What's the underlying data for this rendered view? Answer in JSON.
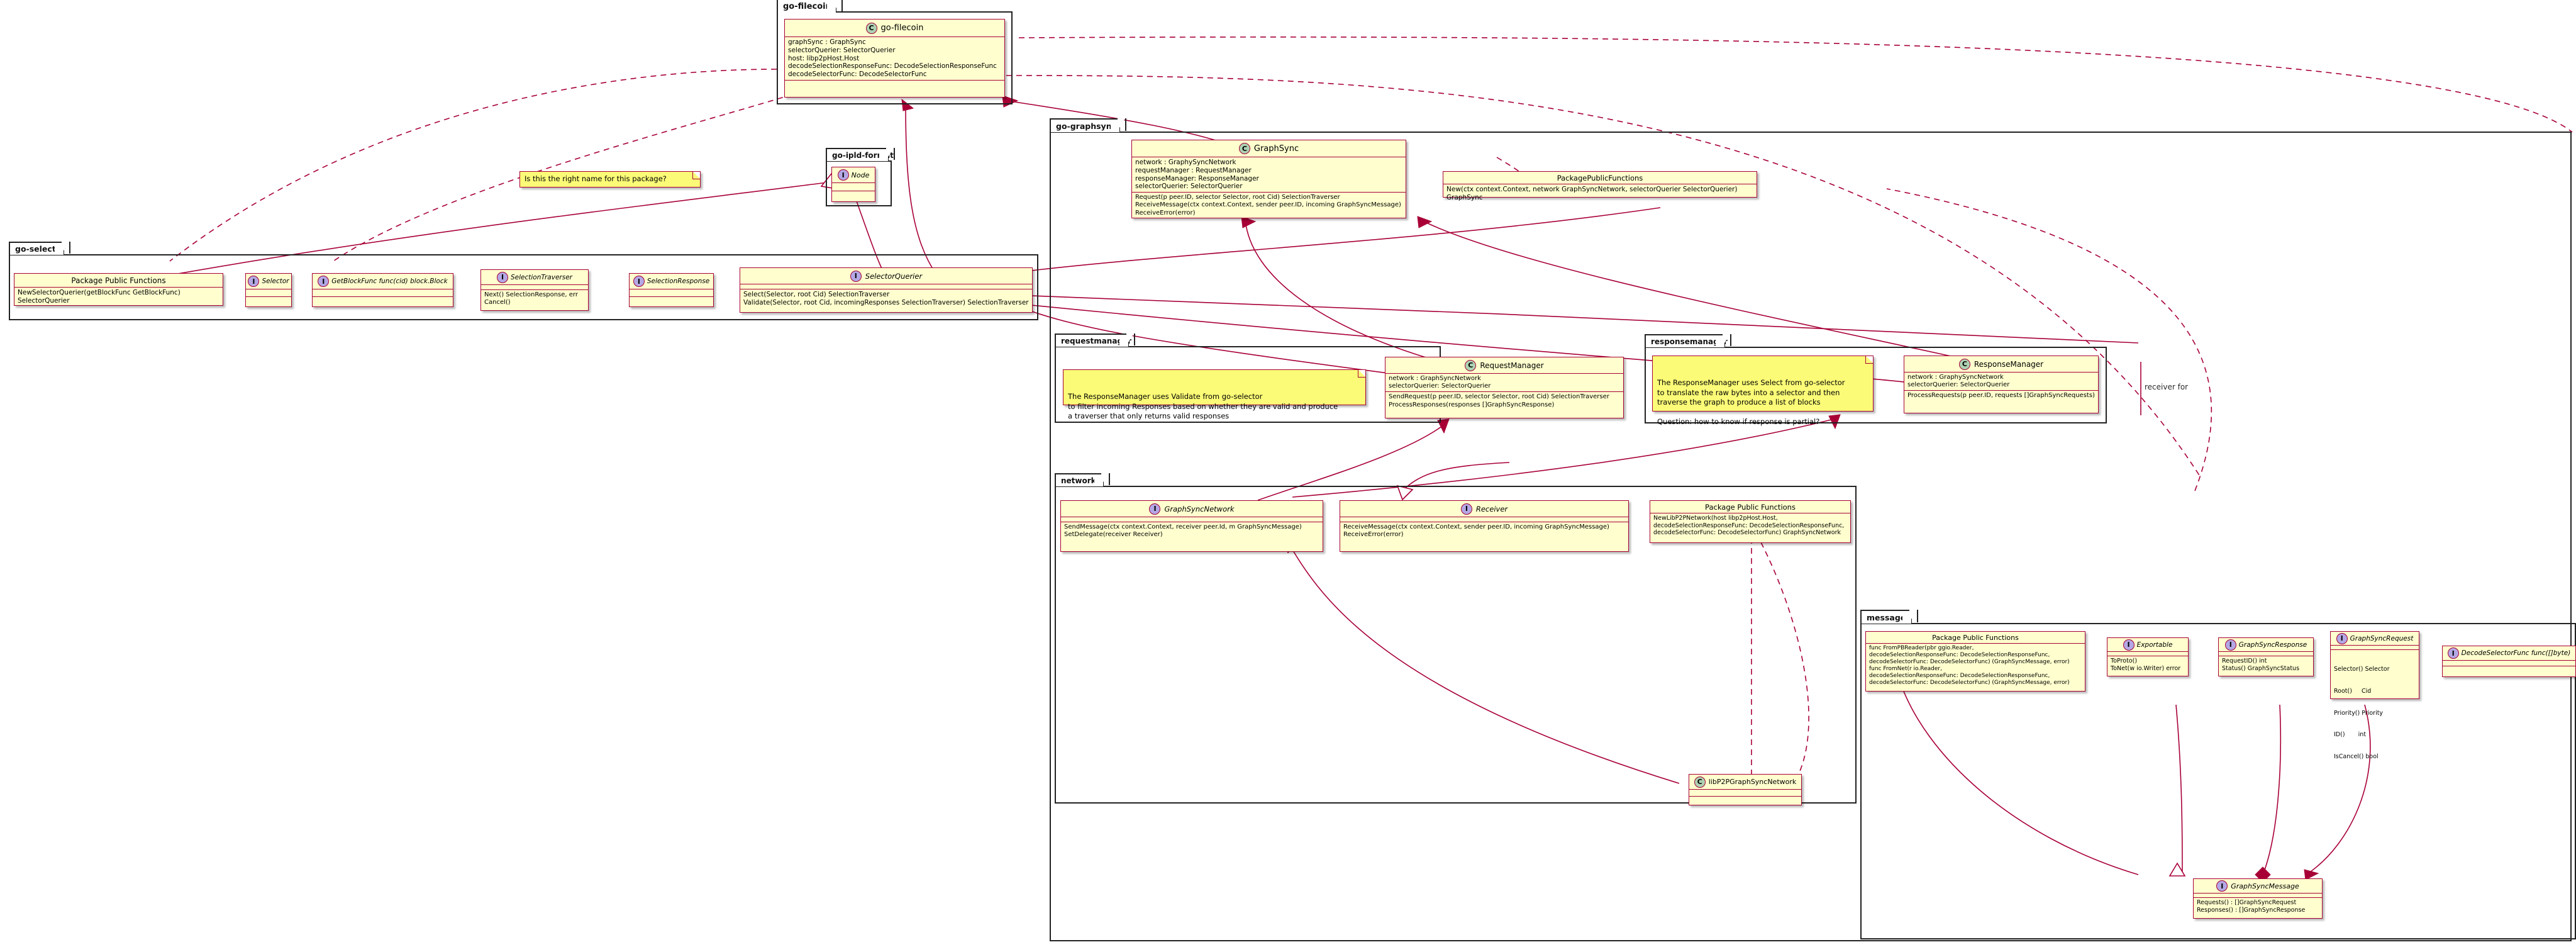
{
  "diagram": {
    "kind": "plantuml-class-diagram",
    "background": "#ffffff",
    "accent": "#A80036",
    "class_fill": "#FEFECE",
    "note_fill": "#FBFB77",
    "class_badge_fill": "#ADD1B2",
    "interface_badge_fill": "#B4A7E5"
  },
  "packages": {
    "go_filecoin": {
      "label": "go-filecoin"
    },
    "go_ipld_format": {
      "label": "go-ipld-format"
    },
    "go_selector": {
      "label": "go-selector"
    },
    "go_graphsync": {
      "label": "go-graphsync"
    },
    "requestmanager": {
      "label": "requestmanager"
    },
    "responsemanager": {
      "label": "responsemanager"
    },
    "network": {
      "label": "network"
    },
    "message": {
      "label": "message"
    }
  },
  "classes": {
    "go_filecoin": {
      "stereotype": "C",
      "name": "go-filecoin",
      "fields": [
        "graphSync : GraphSync",
        "selectorQuerier: SelectorQuerier",
        "host: libp2pHost.Host",
        "decodeSelectionResponseFunc: DecodeSelectionResponseFunc",
        "decodeSelectorFunc: DecodeSelectorFunc"
      ],
      "methods": []
    },
    "node": {
      "stereotype": "I",
      "name": "Node",
      "fields": [],
      "methods": []
    },
    "selector_pkg_funcs": {
      "name": "Package Public Functions",
      "methods": [
        "NewSelectorQuerier(getBlockFunc GetBlockFunc) SelectorQuerier"
      ]
    },
    "selector": {
      "stereotype": "I",
      "name": "Selector",
      "fields": [],
      "methods": []
    },
    "getblockfunc": {
      "stereotype": "I",
      "name": "GetBlockFunc func(cid) block.Block",
      "fields": [],
      "methods": []
    },
    "selection_traverser": {
      "stereotype": "I",
      "name": "SelectionTraverser",
      "fields": [],
      "methods": [
        "Next() SelectionResponse, err",
        "Cancel()"
      ]
    },
    "selection_response": {
      "stereotype": "I",
      "name": "SelectionResponse",
      "fields": [],
      "methods": []
    },
    "selector_querier": {
      "stereotype": "I",
      "name": "SelectorQuerier",
      "fields": [],
      "methods": [
        "Select(Selector, root Cid) SelectionTraverser",
        "Validate(Selector, root Cid, incomingResponses SelectionTraverser) SelectionTraverser"
      ]
    },
    "graphsync": {
      "stereotype": "C",
      "name": "GraphSync",
      "fields": [
        "network : GraphySyncNetwork",
        "requestManager : RequestManager",
        "responseManager: ResponseManager",
        "selectorQuerier: SelectorQuerier"
      ],
      "methods": [
        "Request(p peer.ID, selector Selector, root Cid) SelectionTraverser",
        "ReceiveMessage(ctx context.Context, sender peer.ID, incoming GraphSyncMessage)",
        "ReceiveError(error)"
      ]
    },
    "graphsync_pkg_funcs": {
      "name": "PackagePublicFunctions",
      "methods": [
        "New(ctx context.Context, network GraphSyncNetwork, selectorQuerier SelectorQuerier) GraphSync"
      ]
    },
    "request_manager": {
      "stereotype": "C",
      "name": "RequestManager",
      "fields": [
        "network : GraphSyncNetwork",
        "selectorQuerier: SelectorQuerier"
      ],
      "methods": [
        "SendRequest(p peer.ID, selector Selector, root Cid) SelectionTraverser",
        "ProcessResponses(responses []GraphSyncResponse)"
      ]
    },
    "response_manager": {
      "stereotype": "C",
      "name": "ResponseManager",
      "fields": [
        "network : GraphySyncNetwork",
        "selectorQuerier: SelectorQuerier"
      ],
      "methods": [
        "ProcessRequests(p peer.ID, requests []GraphSyncRequests)"
      ]
    },
    "graphsync_network": {
      "stereotype": "I",
      "name": "GraphSyncNetwork",
      "fields": [],
      "methods": [
        "SendMessage(ctx context.Context, receiver peer.Id, m GraphSyncMessage)",
        "SetDelegate(receiver Receiver)"
      ]
    },
    "receiver": {
      "stereotype": "I",
      "name": "Receiver",
      "fields": [],
      "methods": [
        "ReceiveMessage(ctx context.Context, sender peer.ID, incoming GraphSyncMessage)",
        "ReceiveError(error)"
      ]
    },
    "network_pkg_funcs": {
      "name": "Package Public Functions",
      "methods": [
        "NewLibP2PNetwork(host libp2pHost.Host,",
        "decodeSelectionResponseFunc: DecodeSelectionResponseFunc,",
        "decodeSelectorFunc: DecodeSelectorFunc) GraphSyncNetwork"
      ]
    },
    "libp2p_graphsync_network": {
      "stereotype": "C",
      "name": "libP2PGraphSyncNetwork",
      "fields": [],
      "methods": []
    },
    "message_pkg_funcs": {
      "name": "Package Public Functions",
      "methods": [
        "func FromPBReader(pbr ggio.Reader,",
        "decodeSelectionResponseFunc: DecodeSelectionResponseFunc,",
        "decodeSelectorFunc: DecodeSelectorFunc) (GraphSyncMessage, error)",
        "func FromNet(r io.Reader,",
        "decodeSelectionResponseFunc: DecodeSelectionResponseFunc,",
        "decodeSelectorFunc: DecodeSelectorFunc) (GraphSyncMessage, error)"
      ]
    },
    "exportable": {
      "stereotype": "I",
      "name": "Exportable",
      "fields": [],
      "methods": [
        "ToProto()",
        "ToNet(w io.Writer) error"
      ]
    },
    "graphsync_response": {
      "stereotype": "I",
      "name": "GraphSyncResponse",
      "fields": [],
      "methods": [
        "RequestID() int",
        "Status() GraphSyncStatus"
      ]
    },
    "graphsync_request": {
      "stereotype": "I",
      "name": "GraphSyncRequest",
      "fields": [],
      "methods": [
        "Selector() Selector",
        "Root()     Cid",
        "Priority() Priority",
        "ID()       int",
        "IsCancel() bool"
      ]
    },
    "decode_selector_func": {
      "stereotype": "I",
      "name": "DecodeSelectorFunc func([]byte)",
      "fields": [],
      "methods": []
    },
    "graphsync_message": {
      "stereotype": "I",
      "name": "GraphSyncMessage",
      "fields": [],
      "methods": [
        "Requests() : []GraphSyncRequest",
        "Responses() : []GraphSyncResponse"
      ]
    }
  },
  "notes": {
    "package_name_question": "Is this the right name for this package?",
    "requestmanager_note": "The ResponseManager uses Validate from go-selector\nto filter incoming Responses based on whether they are valid and produce\na traverser that only returns valid responses",
    "responsemanager_note": "The ResponseManager uses Select from go-selector\nto translate the raw bytes into a selector and then\ntraverse the graph to produce a list of blocks\n\nQuestion: how to know if response is partial?"
  },
  "labels": {
    "receiver_for": "receiver for"
  }
}
